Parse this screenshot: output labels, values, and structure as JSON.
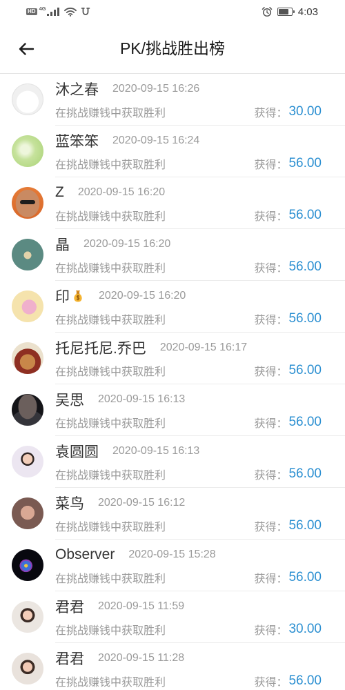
{
  "status_bar": {
    "hd_badge": "HD",
    "network": "4G",
    "signal_level": 4,
    "battery_level": 0.8,
    "time": "4:03",
    "icons": [
      "signal-icon",
      "wifi-icon",
      "app-notification-icon",
      "alarm-icon",
      "battery-icon"
    ]
  },
  "header": {
    "back_icon": "back-arrow-icon",
    "title": "PK/挑战胜出榜"
  },
  "theme": {
    "accent": "#2b8fd1"
  },
  "list": {
    "items": [
      {
        "name": "沐之春",
        "time": "2020-09-15 16:26",
        "description": "在挑战赚钱中获取胜利",
        "reward_label": "获得：",
        "reward": "30.00"
      },
      {
        "name": "蓝笨笨",
        "time": "2020-09-15 16:24",
        "description": "在挑战赚钱中获取胜利",
        "reward_label": "获得：",
        "reward": "56.00"
      },
      {
        "name": "Z",
        "time": "2020-09-15 16:20",
        "description": "在挑战赚钱中获取胜利",
        "reward_label": "获得：",
        "reward": "56.00"
      },
      {
        "name": "晶",
        "time": "2020-09-15 16:20",
        "description": "在挑战赚钱中获取胜利",
        "reward_label": "获得：",
        "reward": "56.00"
      },
      {
        "name": "印",
        "name_icon": "money-bag-icon",
        "time": "2020-09-15 16:20",
        "description": "在挑战赚钱中获取胜利",
        "reward_label": "获得：",
        "reward": "56.00"
      },
      {
        "name": "托尼托尼.乔巴",
        "time": "2020-09-15 16:17",
        "description": "在挑战赚钱中获取胜利",
        "reward_label": "获得：",
        "reward": "56.00"
      },
      {
        "name": "吴思",
        "time": "2020-09-15 16:13",
        "description": "在挑战赚钱中获取胜利",
        "reward_label": "获得：",
        "reward": "56.00"
      },
      {
        "name": "袁圆圆",
        "time": "2020-09-15 16:13",
        "description": "在挑战赚钱中获取胜利",
        "reward_label": "获得：",
        "reward": "56.00"
      },
      {
        "name": "菜鸟",
        "time": "2020-09-15 16:12",
        "description": "在挑战赚钱中获取胜利",
        "reward_label": "获得：",
        "reward": "56.00"
      },
      {
        "name": "Observer",
        "time": "2020-09-15 15:28",
        "description": "在挑战赚钱中获取胜利",
        "reward_label": "获得：",
        "reward": "56.00"
      },
      {
        "name": "君君",
        "time": "2020-09-15 11:59",
        "description": "在挑战赚钱中获取胜利",
        "reward_label": "获得：",
        "reward": "30.00"
      },
      {
        "name": "君君",
        "time": "2020-09-15 11:28",
        "description": "在挑战赚钱中获取胜利",
        "reward_label": "获得：",
        "reward": "56.00"
      }
    ]
  }
}
